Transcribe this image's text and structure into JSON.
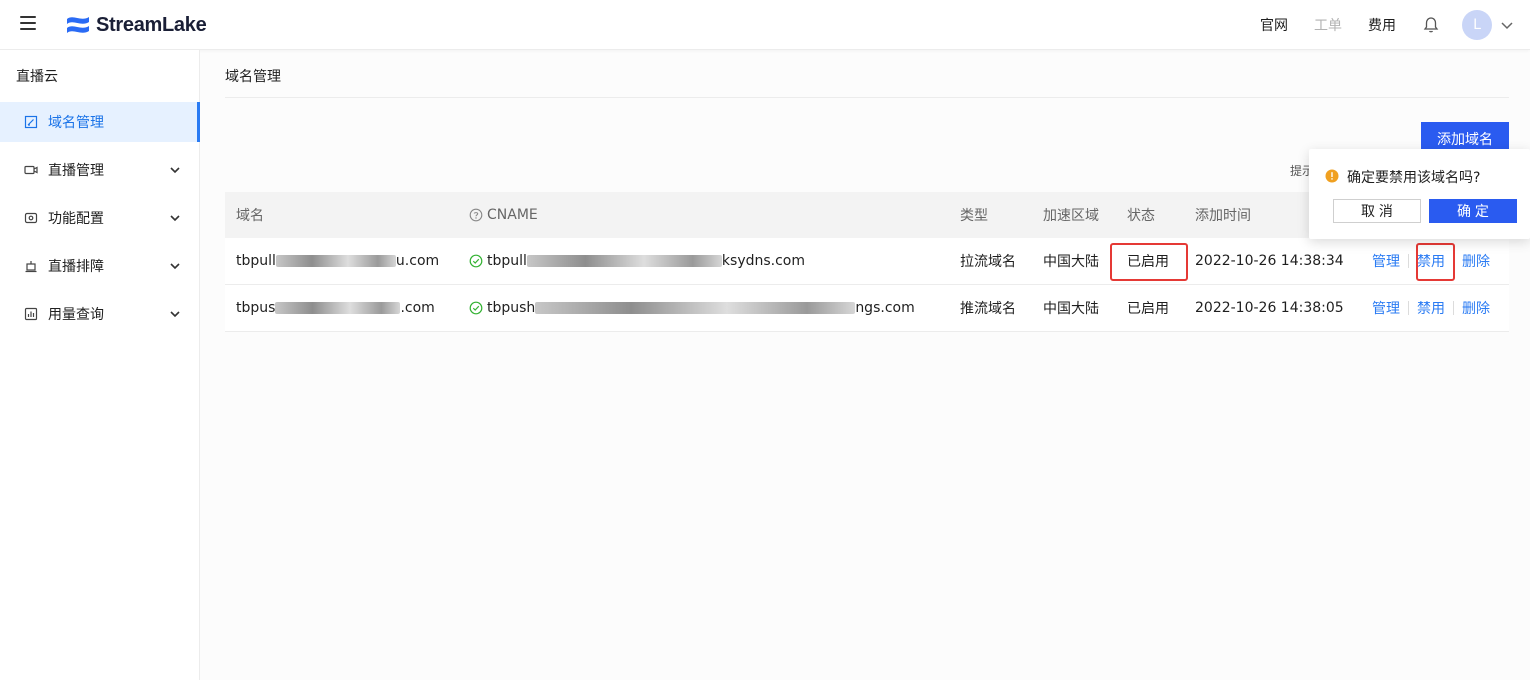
{
  "header": {
    "logo_text": "StreamLake",
    "nav": {
      "official": "官网",
      "ticket": "工单",
      "billing": "费用"
    },
    "avatar_letter": "L"
  },
  "sidebar": {
    "title": "直播云",
    "items": [
      {
        "label": "域名管理",
        "icon": "domain-edit-icon",
        "active": true
      },
      {
        "label": "直播管理",
        "icon": "camera-icon"
      },
      {
        "label": "功能配置",
        "icon": "config-icon"
      },
      {
        "label": "直播排障",
        "icon": "troubleshoot-icon"
      },
      {
        "label": "用量查询",
        "icon": "usage-chart-icon"
      }
    ]
  },
  "main": {
    "page_title": "域名管理",
    "add_button": "添加域名",
    "hint": "提示",
    "table": {
      "headers": {
        "domain": "域名",
        "cname": "CNAME",
        "type": "类型",
        "region": "加速区域",
        "status": "状态",
        "time": "添加时间"
      },
      "rows": [
        {
          "domain_prefix": "tbpull",
          "domain_suffix": "u.com",
          "cname_prefix": "tbpull",
          "cname_suffix": "ksydns.com",
          "type": "拉流域名",
          "region": "中国大陆",
          "status": "已启用",
          "time": "2022-10-26 14:38:34"
        },
        {
          "domain_prefix": "tbpus",
          "domain_suffix": ".com",
          "cname_prefix": "tbpush",
          "cname_suffix": "ngs.com",
          "type": "推流域名",
          "region": "中国大陆",
          "status": "已启用",
          "time": "2022-10-26 14:38:05"
        }
      ],
      "actions": {
        "manage": "管理",
        "disable": "禁用",
        "delete": "删除"
      }
    }
  },
  "popconfirm": {
    "message": "确定要禁用该域名吗?",
    "cancel": "取 消",
    "confirm": "确 定"
  },
  "colors": {
    "primary": "#2a5bf0",
    "link": "#2a7bf3",
    "highlight": "#e53935",
    "warning": "#f0a020",
    "success": "#34b233"
  }
}
